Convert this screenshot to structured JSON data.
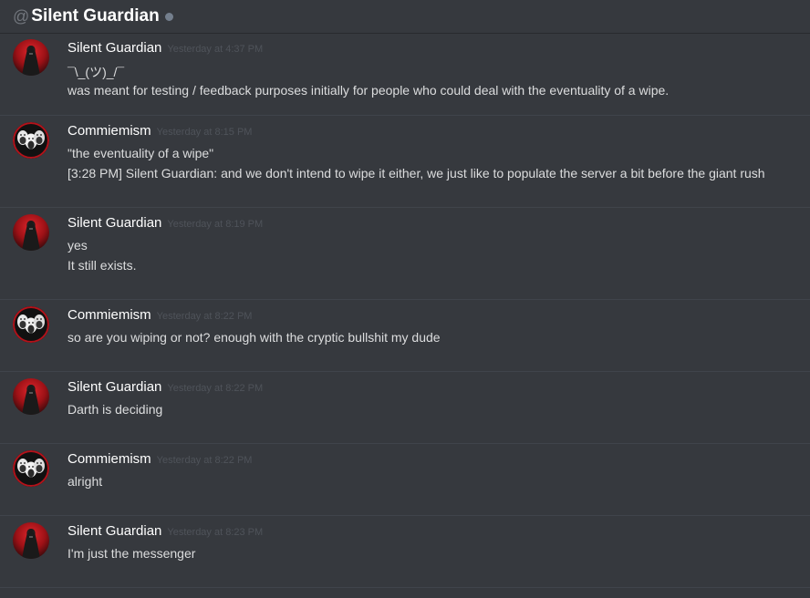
{
  "header": {
    "at_symbol": "@",
    "title": "Silent Guardian"
  },
  "colors": {
    "background": "#36393e",
    "status_offline": "#747f8d",
    "divider": "#40444b"
  },
  "messages": [
    {
      "author": "Silent Guardian",
      "avatar": "silent-guardian-avatar",
      "timestamp": "Yesterday at 4:37 PM",
      "lines": [
        "¯\\_(ツ)_/¯",
        "was meant for testing / feedback purposes initially for people who could deal with the eventuality of a wipe."
      ]
    },
    {
      "author": "Commiemism",
      "avatar": "commiemism-avatar",
      "timestamp": "Yesterday at 8:15 PM",
      "lines": [
        "\"the eventuality of a wipe\"",
        "[3:28 PM] Silent Guardian: and we don't intend to wipe it either, we just like to populate the server a bit before the giant rush"
      ]
    },
    {
      "author": "Silent Guardian",
      "avatar": "silent-guardian-avatar",
      "timestamp": "Yesterday at 8:19 PM",
      "lines": [
        "yes",
        "It still exists."
      ]
    },
    {
      "author": "Commiemism",
      "avatar": "commiemism-avatar",
      "timestamp": "Yesterday at 8:22 PM",
      "lines": [
        "so are you wiping or not? enough with the cryptic bullshit my dude"
      ]
    },
    {
      "author": "Silent Guardian",
      "avatar": "silent-guardian-avatar",
      "timestamp": "Yesterday at 8:22 PM",
      "lines": [
        "Darth is deciding"
      ]
    },
    {
      "author": "Commiemism",
      "avatar": "commiemism-avatar",
      "timestamp": "Yesterday at 8:22 PM",
      "lines": [
        "alright"
      ]
    },
    {
      "author": "Silent Guardian",
      "avatar": "silent-guardian-avatar",
      "timestamp": "Yesterday at 8:23 PM",
      "lines": [
        "I'm just the messenger"
      ]
    }
  ]
}
